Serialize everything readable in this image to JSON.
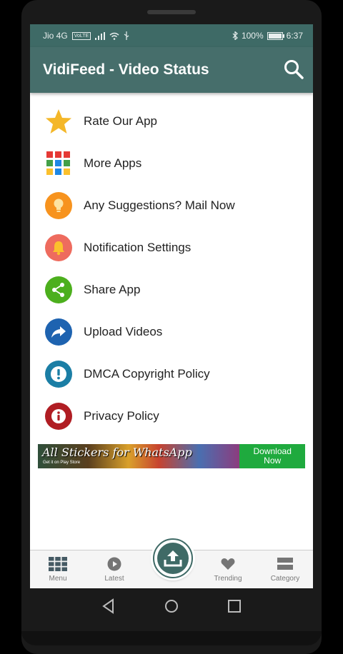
{
  "status": {
    "carrier": "Jio 4G",
    "volte": "VoLTE",
    "battery": "100%",
    "time": "6:37"
  },
  "appbar": {
    "title": "VidiFeed - Video Status",
    "search_icon": "search-icon"
  },
  "menu": [
    {
      "label": "Rate Our App",
      "icon": "star-icon",
      "color": "#f4b729"
    },
    {
      "label": "More Apps",
      "icon": "apps-grid-icon"
    },
    {
      "label": "Any Suggestions? Mail Now",
      "icon": "lightbulb-icon",
      "color": "#f7931e"
    },
    {
      "label": "Notification Settings",
      "icon": "bell-icon",
      "color": "#ee6b5e"
    },
    {
      "label": "Share App",
      "icon": "share-icon",
      "color": "#4caf1d"
    },
    {
      "label": "Upload Videos",
      "icon": "forward-arrow-icon",
      "color": "#1e63b0"
    },
    {
      "label": "DMCA Copyright Policy",
      "icon": "alert-icon",
      "color": "#1b7ea5"
    },
    {
      "label": "Privacy Policy",
      "icon": "info-icon",
      "color": "#b01d23"
    }
  ],
  "banner": {
    "headline": "All Stickers for WhatsApp",
    "subline": "Get it on Play Store",
    "cta": "Download Now",
    "cta_color": "#1faa3e"
  },
  "bottom_nav": [
    {
      "label": "Menu",
      "icon": "grid-icon"
    },
    {
      "label": "Latest",
      "icon": "play-circle-icon"
    },
    {
      "label": "Trending",
      "icon": "heart-icon"
    },
    {
      "label": "Category",
      "icon": "category-icon"
    }
  ],
  "fab": {
    "icon": "upload-icon",
    "color": "#3f6a66"
  },
  "accent": "#466e6b"
}
